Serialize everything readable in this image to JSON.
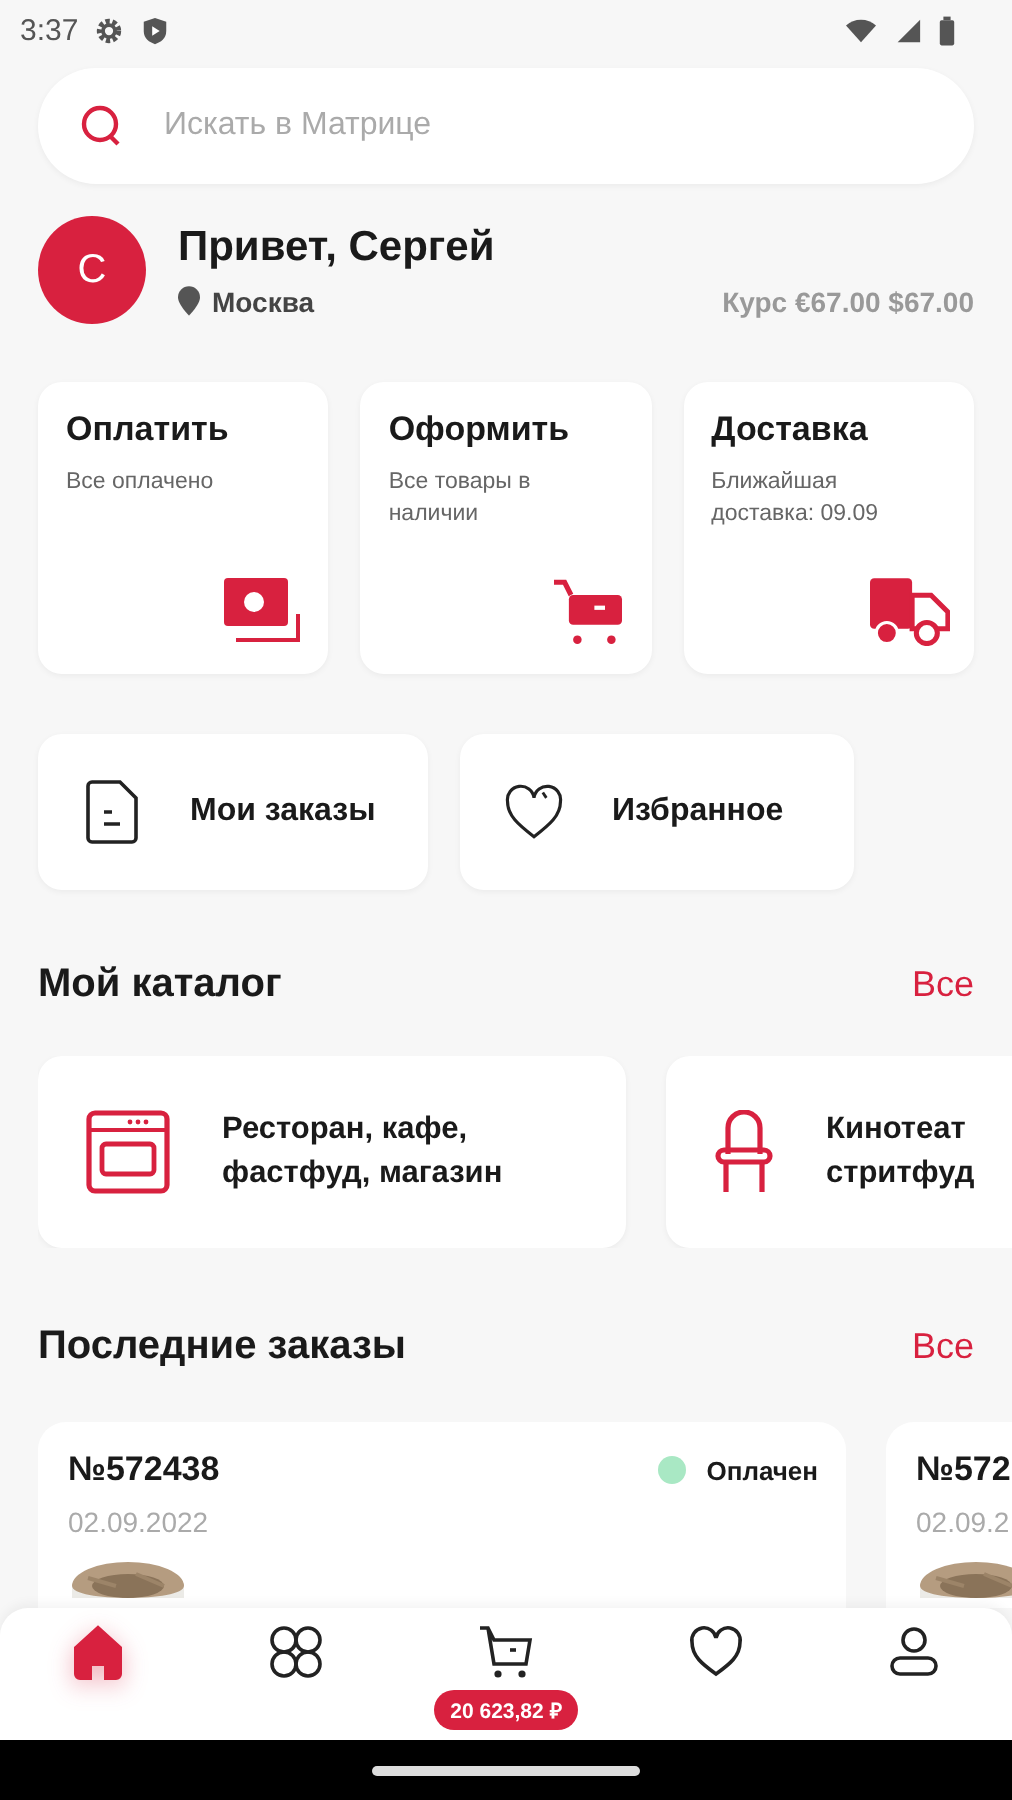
{
  "status_bar": {
    "time": "3:37"
  },
  "search": {
    "placeholder": "Искать в Матрице"
  },
  "profile": {
    "avatar_letter": "С",
    "greeting": "Привет, Сергей",
    "city": "Москва",
    "rate": "Курс €67.00 $67.00"
  },
  "action_cards": [
    {
      "kind": "pay",
      "title": "Оплатить",
      "subtitle": "Все оплачено"
    },
    {
      "kind": "checkout",
      "title": "Оформить",
      "subtitle": "Все товары в наличии"
    },
    {
      "kind": "delivery",
      "title": "Доставка",
      "subtitle": "Ближайшая доставка: 09.09"
    }
  ],
  "quick_links": [
    {
      "kind": "orders",
      "label": "Мои заказы"
    },
    {
      "kind": "favorites",
      "label": "Избранное"
    }
  ],
  "catalog": {
    "title": "Мой каталог",
    "all_link": "Все",
    "items": [
      {
        "kind": "oven",
        "lines": [
          "Ресторан, кафе,",
          "фастфуд, магазин"
        ]
      },
      {
        "kind": "chair",
        "lines": [
          "Кинотеат",
          "стритфуд"
        ]
      }
    ]
  },
  "recent_orders": {
    "title": "Последние заказы",
    "all_link": "Все",
    "orders": [
      {
        "number": "№572438",
        "date": "02.09.2022",
        "status": "Оплачен",
        "color": "#a9e8c4"
      },
      {
        "number": "№572",
        "date": "02.09.2"
      }
    ]
  },
  "bottom_nav": {
    "items": [
      {
        "kind": "home",
        "selected": true
      },
      {
        "kind": "catalog",
        "selected": false
      },
      {
        "kind": "cart",
        "selected": false,
        "badge": "20 623,82 ₽"
      },
      {
        "kind": "favorites",
        "selected": false
      },
      {
        "kind": "profile",
        "selected": false
      }
    ]
  }
}
